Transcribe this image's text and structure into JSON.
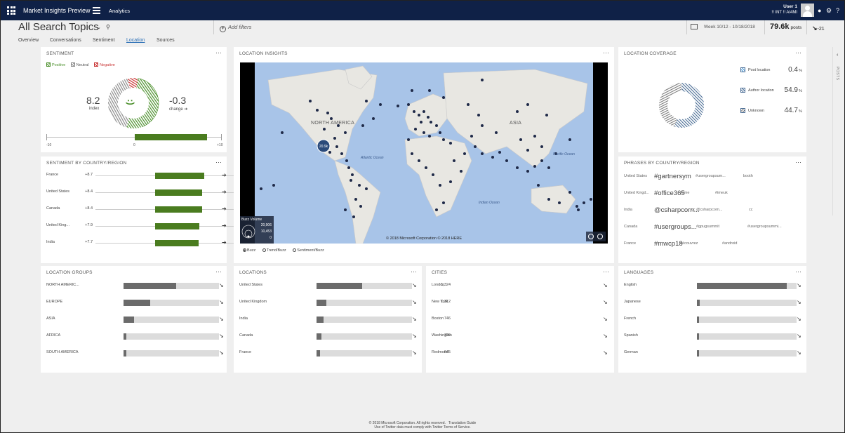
{
  "app": {
    "title": "Market Insights Preview",
    "section": "Analytics",
    "user_name": "User 1",
    "user_org": "!! INT !! AI4MI"
  },
  "header": {
    "title": "All Search Topics",
    "add_filters": "Add filters",
    "week": "Week 10/12 - 10/18/2018",
    "posts_value": "79.6k",
    "posts_label": "posts",
    "delta": "-21"
  },
  "tabs": [
    {
      "label": "Overview"
    },
    {
      "label": "Conversations"
    },
    {
      "label": "Sentiment"
    },
    {
      "label": "Location",
      "active": true
    },
    {
      "label": "Sources"
    }
  ],
  "sentiment": {
    "title": "SENTIMENT",
    "legend": [
      "Positive",
      "Neutral",
      "Negative"
    ],
    "index_value": "8.2",
    "index_label": "index",
    "change_value": "-0.3",
    "change_label": "change",
    "scale": [
      "-10",
      "0",
      "+10"
    ],
    "smiley": ":)",
    "bar_fraction": 0.41,
    "colors": {
      "positive": "#4a8f2a",
      "neutral": "#8a8a8a",
      "negative": "#c83232"
    }
  },
  "sentiment_by_country": {
    "title": "SENTIMENT BY COUNTRY/REGION",
    "rows": [
      {
        "label": "France",
        "value": "+8.7",
        "fraction": 0.87
      },
      {
        "label": "United States",
        "value": "+8.4",
        "fraction": 0.84
      },
      {
        "label": "Canada",
        "value": "+8.4",
        "fraction": 0.84
      },
      {
        "label": "United King...",
        "value": "+7.9",
        "fraction": 0.79
      },
      {
        "label": "India",
        "value": "+7.7",
        "fraction": 0.77
      }
    ]
  },
  "location_insights": {
    "title": "LOCATION INSIGHTS",
    "copyright": "© 2018 Microsoft Corporation © 2018 HERE",
    "labels": {
      "na": "NORTH AMERICA",
      "asia": "ASIA",
      "atlantic": "Atlantic Ocean",
      "indian": "Indian Ocean",
      "pacific": "Pacific Ocean"
    },
    "cluster": "20.9k",
    "buzz": {
      "title": "Buzz Volume",
      "values": [
        "20,906",
        "10,453",
        "0"
      ]
    },
    "modes": [
      "Buzz",
      "Trend/Buzz",
      "Sentiment/Buzz"
    ]
  },
  "location_coverage": {
    "title": "LOCATION COVERAGE",
    "items": [
      {
        "label": "Post location",
        "value": "0.4",
        "unit": "%"
      },
      {
        "label": "Author location",
        "value": "54.9",
        "unit": "%"
      },
      {
        "label": "Unknown",
        "value": "44.7",
        "unit": "%"
      }
    ]
  },
  "phrases": {
    "title": "PHRASES BY COUNTRY/REGION",
    "rows": [
      {
        "country": "United States",
        "p1": "#gartnersym",
        "p2": "#usergroupsum...",
        "p3": "booth"
      },
      {
        "country": "United Kingd...",
        "p1": "#office365",
        "p2": "#sme",
        "p3": "#imeuk"
      },
      {
        "country": "India",
        "p1": "@csharpcorn...",
        "p2": "cc @csharpcorn...",
        "p3": "cc"
      },
      {
        "country": "Canada",
        "p1": "#usergroups...",
        "p2": "#gpugsummit",
        "p3": "#usergroupsummi..."
      },
      {
        "country": "France",
        "p1": "#mwcp18",
        "p2": "découvrez",
        "p3": "#android"
      }
    ]
  },
  "location_groups": {
    "title": "LOCATION GROUPS",
    "rows": [
      {
        "label": "NORTH AMERIC...",
        "value": "23,499",
        "fraction": 0.55
      },
      {
        "label": "EUROPE",
        "value": "12,045",
        "fraction": 0.28
      },
      {
        "label": "ASIA",
        "value": "4,469",
        "fraction": 0.11
      },
      {
        "label": "AFRICA",
        "value": "1,280",
        "fraction": 0.03
      },
      {
        "label": "SOUTH AMERICA",
        "value": "1,267",
        "fraction": 0.03
      }
    ]
  },
  "locations": {
    "title": "LOCATIONS",
    "rows": [
      {
        "label": "United States",
        "value": "20,906",
        "fraction": 0.48
      },
      {
        "label": "United Kingdom",
        "value": "4,198",
        "fraction": 0.1
      },
      {
        "label": "India",
        "value": "3,131",
        "fraction": 0.07
      },
      {
        "label": "Canada",
        "value": "2,023",
        "fraction": 0.05
      },
      {
        "label": "France",
        "value": "1,676",
        "fraction": 0.04
      }
    ]
  },
  "cities": {
    "title": "CITIES",
    "rows": [
      {
        "label": "London",
        "value": "1,324"
      },
      {
        "label": "New York",
        "value": "1,312"
      },
      {
        "label": "Boston",
        "value": "746"
      },
      {
        "label": "Washington",
        "value": "726"
      },
      {
        "label": "Redmond",
        "value": "645"
      }
    ]
  },
  "languages": {
    "title": "LANGUAGES",
    "rows": [
      {
        "label": "English",
        "value": "71,671",
        "fraction": 0.9
      },
      {
        "label": "Japanese",
        "value": "2,600",
        "fraction": 0.03
      },
      {
        "label": "French",
        "value": "1,535",
        "fraction": 0.02
      },
      {
        "label": "Spanish",
        "value": "1,253",
        "fraction": 0.02
      },
      {
        "label": "German",
        "value": "796",
        "fraction": 0.01
      }
    ]
  },
  "side_tab": "POSTS",
  "footer": {
    "line1": "© 2018 Microsoft Corporation. All rights reserved.",
    "translation": "Translation Guide",
    "line2": "Use of Twitter data must comply with Twitter Terms of Service."
  }
}
